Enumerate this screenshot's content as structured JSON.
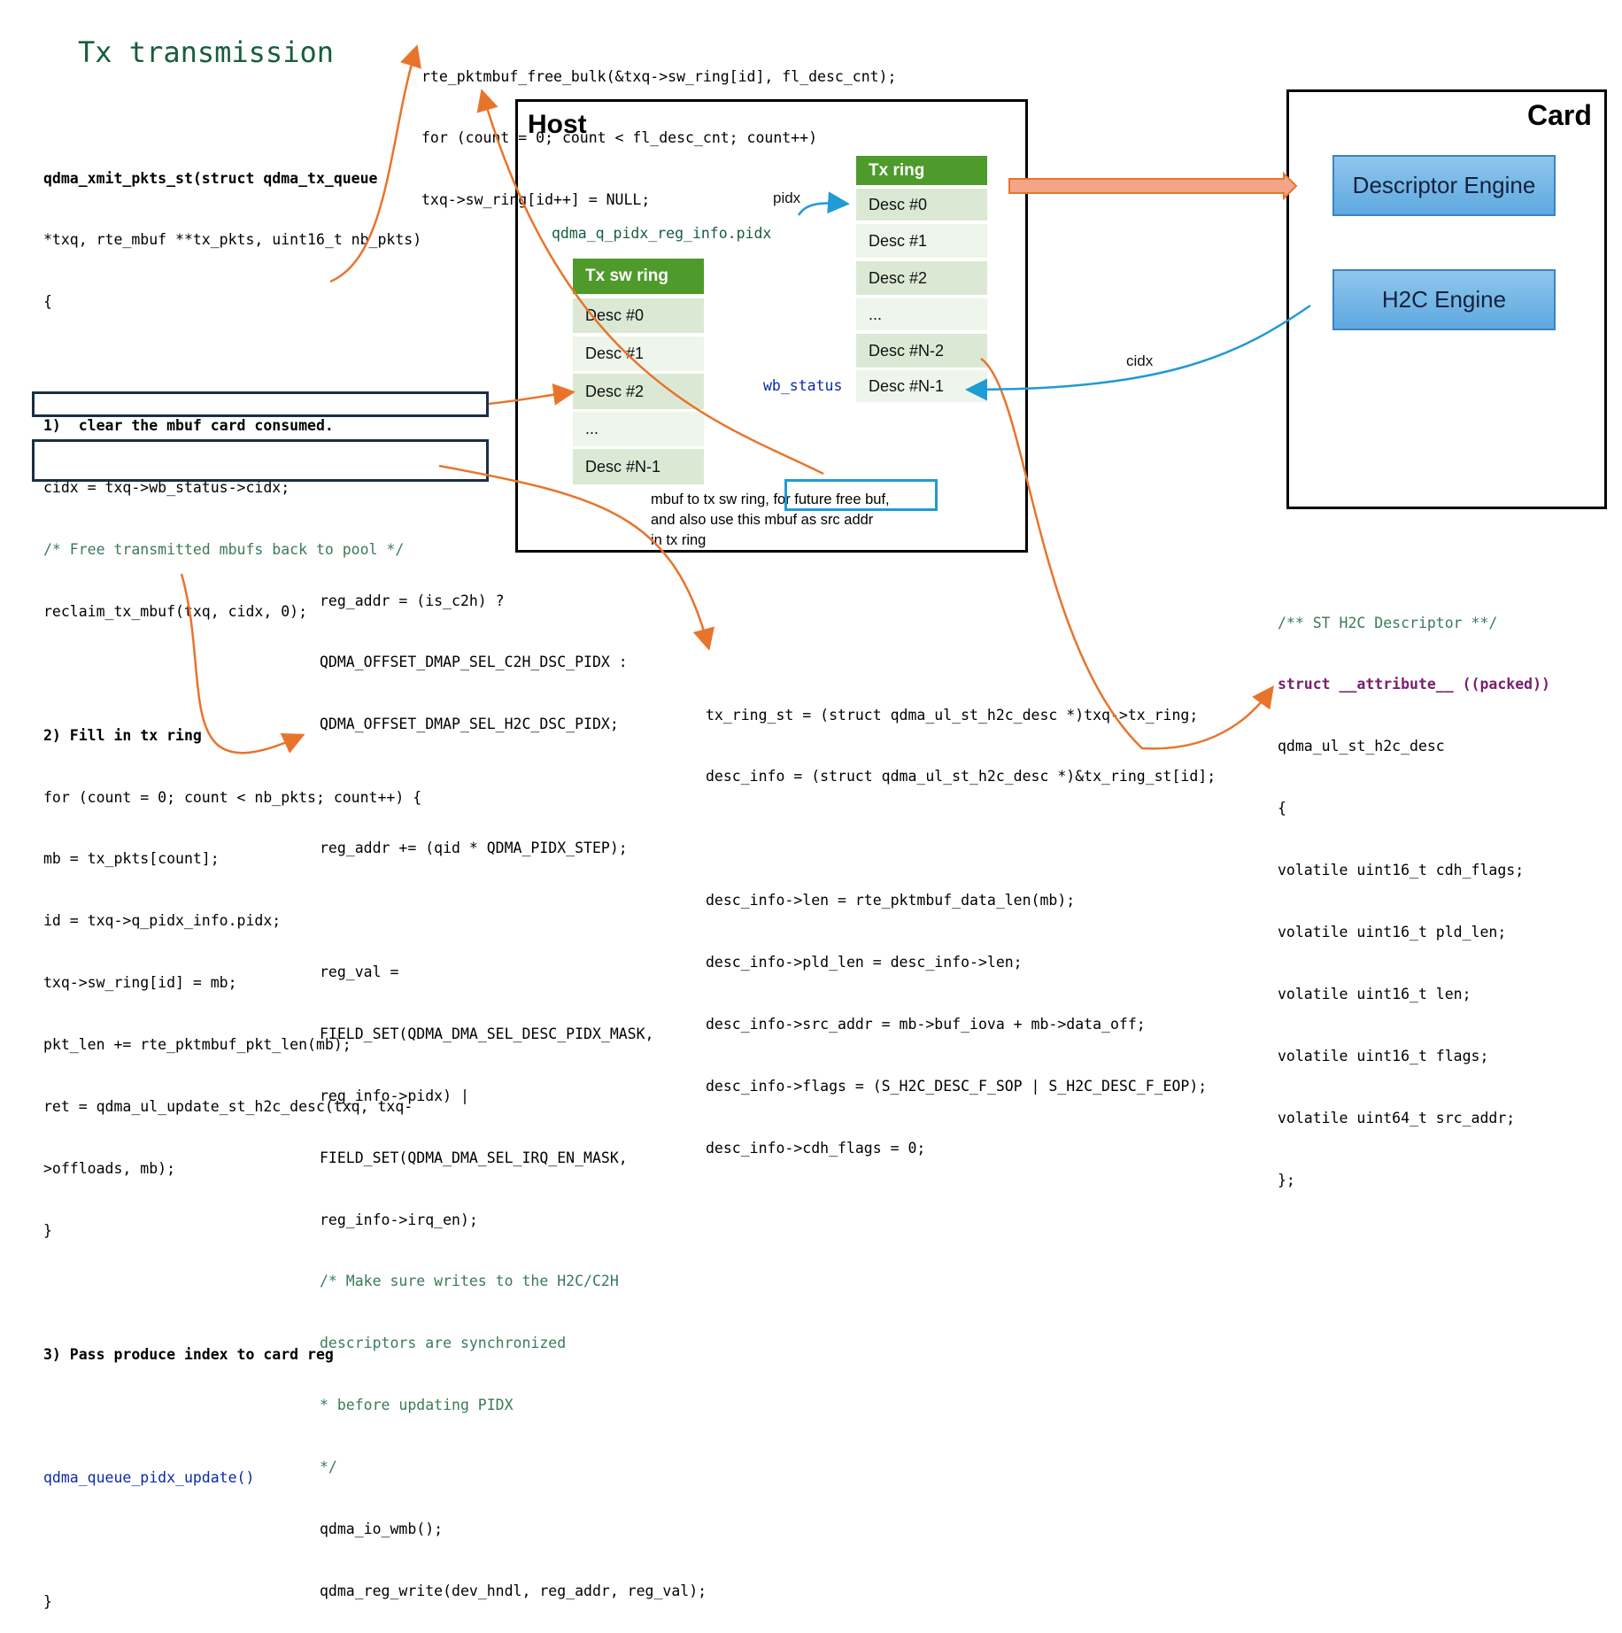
{
  "title": "Tx transmission",
  "left_code": {
    "signature": [
      "qdma_xmit_pkts_st(struct qdma_tx_queue",
      "*txq, rte_mbuf **tx_pkts, uint16_t nb_pkts)",
      "{"
    ],
    "step1": "1)  clear the mbuf card consumed.",
    "step1_lines": [
      "cidx = txq->wb_status->cidx;",
      "/* Free transmitted mbufs back to pool */",
      "reclaim_tx_mbuf(txq, cidx, 0);"
    ],
    "step2": "2) Fill in tx ring",
    "step2_lines": [
      "for (count = 0; count < nb_pkts; count++) {",
      "mb = tx_pkts[count];",
      "id = txq->q_pidx_info.pidx;",
      "txq->sw_ring[id] = mb;",
      "pkt_len += rte_pktmbuf_pkt_len(mb);",
      "ret = qdma_ul_update_st_h2c_desc(txq, txq-",
      ">offloads, mb);",
      "}"
    ],
    "step3": "3) Pass produce index to card reg",
    "step3_lines": [
      "qdma_queue_pidx_update()",
      "",
      "}"
    ]
  },
  "top_code": [
    "rte_pktmbuf_free_bulk(&txq->sw_ring[id], fl_desc_cnt);",
    "for (count = 0; count < fl_desc_cnt; count++)",
    "txq->sw_ring[id++] = NULL;"
  ],
  "host": {
    "label": "Host",
    "pidx_label": "pidx",
    "pidx_reg": "qdma_q_pidx_reg_info.pidx",
    "wb_status": "wb_status",
    "tx_ring": {
      "header": "Tx ring",
      "cells": [
        "Desc #0",
        "Desc #1",
        "Desc #2",
        "...",
        "Desc #N-2",
        "Desc #N-1"
      ]
    },
    "tx_sw_ring": {
      "header": "Tx sw ring",
      "cells": [
        "Desc #0",
        "Desc #1",
        "Desc #2",
        "...",
        "Desc #N-1"
      ]
    },
    "note": [
      "mbuf to tx sw ring, for future free buf,",
      "and also use this mbuf as src addr",
      "in tx ring"
    ]
  },
  "card": {
    "label": "Card",
    "descriptor_engine": "Descriptor Engine",
    "h2c_engine": "H2C Engine",
    "cidx_label": "cidx"
  },
  "pidx_code": [
    "reg_addr = (is_c2h) ?",
    "QDMA_OFFSET_DMAP_SEL_C2H_DSC_PIDX :",
    "QDMA_OFFSET_DMAP_SEL_H2C_DSC_PIDX;",
    "",
    "reg_addr += (qid * QDMA_PIDX_STEP);",
    "",
    "reg_val =",
    "FIELD_SET(QDMA_DMA_SEL_DESC_PIDX_MASK,",
    "reg_info->pidx) |",
    "FIELD_SET(QDMA_DMA_SEL_IRQ_EN_MASK,",
    "reg_info->irq_en);",
    "/* Make sure writes to the H2C/C2H",
    "descriptors are synchronized",
    "* before updating PIDX",
    "*/",
    "qdma_io_wmb();",
    "qdma_reg_write(dev_hndl, reg_addr, reg_val);"
  ],
  "desc_code": [
    "tx_ring_st = (struct qdma_ul_st_h2c_desc *)txq->tx_ring;",
    "desc_info = (struct qdma_ul_st_h2c_desc *)&tx_ring_st[id];",
    "",
    "desc_info->len = rte_pktmbuf_data_len(mb);",
    "desc_info->pld_len = desc_info->len;",
    "desc_info->src_addr = mb->buf_iova + mb->data_off;",
    "desc_info->flags = (S_H2C_DESC_F_SOP | S_H2C_DESC_F_EOP);",
    "desc_info->cdh_flags = 0;"
  ],
  "struct_code": [
    "/** ST H2C Descriptor **/",
    "struct __attribute__ ((packed))",
    "qdma_ul_st_h2c_desc",
    "{",
    "volatile uint16_t cdh_flags;",
    "volatile uint16_t pld_len;",
    "volatile uint16_t len;",
    "volatile uint16_t flags;",
    "volatile uint64_t src_addr;",
    "};"
  ],
  "colors": {
    "arrow_orange": "#e8742c",
    "arrow_blue": "#1f9bd5",
    "ring_header": "#4e9a2b",
    "ring_cell": "#dbe9d4",
    "title_green": "#175e3c"
  }
}
